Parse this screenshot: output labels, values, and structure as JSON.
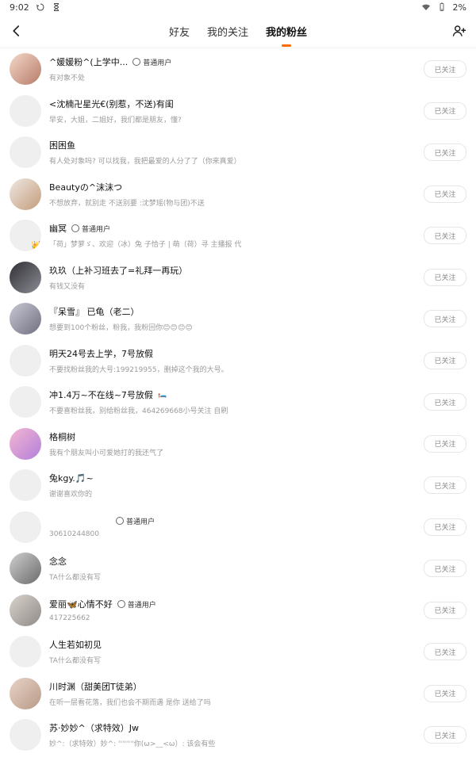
{
  "status_bar": {
    "time": "9:02",
    "battery": "2%"
  },
  "header": {
    "tabs": [
      {
        "label": "好友",
        "active": false
      },
      {
        "label": "我的关注",
        "active": false
      },
      {
        "label": "我的粉丝",
        "active": true
      }
    ]
  },
  "list": {
    "follow_label": "已关注",
    "items": [
      {
        "name": "^媛媛粉^(上学中...",
        "badge": "普通用户",
        "sub": "有对象不处",
        "avatar_icon": "user-photo"
      },
      {
        "name": "<沈楠卍星光€(别惹，不送)有闺",
        "badge": "",
        "sub": "早安，大姐，二姐好，我们都是朋友，懂?",
        "avatar_icon": ""
      },
      {
        "name": "困困鱼",
        "badge": "",
        "sub": "有人处对象吗? 可以找我，我把最爱的人分了了（你来真爱）",
        "avatar_icon": ""
      },
      {
        "name": "Beautyの^沫沫つ",
        "badge": "",
        "sub": "不想放弃，就别走 不送别要 :沈梦瑶(物与团)不送",
        "avatar_icon": "user-photo"
      },
      {
        "name": "幽冥",
        "badge": "普通用户",
        "sub": "「荷」梦萝ゞ、欢迎（冰）兔 子恰子 | 萌（荷）寻 主播报 代",
        "avatar_icon": "crown"
      },
      {
        "name": "玖玖（上补习班去了=礼拜一再玩）",
        "badge": "",
        "sub": "有钱又没有",
        "avatar_icon": "user-photo"
      },
      {
        "name": "『呆雪』 已龟（老二）",
        "badge": "",
        "sub": "想要到100个粉丝，粉我，我粉回你😊😊😊😊",
        "avatar_icon": "user-photo"
      },
      {
        "name": "明天24号去上学，7号放假",
        "badge": "",
        "sub": "不要找粉丝我的大号:199219955，删掉这个我的大号。",
        "avatar_icon": ""
      },
      {
        "name": "冲1.4万~不在线~7号放假",
        "badge": "",
        "sub": "不要喜粉丝我，别给粉丝我，464269668小号关注 自刷",
        "avatar_icon": ""
      },
      {
        "name": "格桐树",
        "badge": "",
        "sub": "我有个朋友叫小可爱她打的我还气了",
        "avatar_icon": "user-photo"
      },
      {
        "name": "兔kgy.🎵~",
        "badge": "",
        "sub": "谢谢喜欢你的",
        "avatar_icon": ""
      },
      {
        "name": "",
        "badge": "普通用户",
        "sub": "30610244800",
        "avatar_icon": ""
      },
      {
        "name": "念念",
        "badge": "",
        "sub": "TA什么都没有写",
        "avatar_icon": "user-photo"
      },
      {
        "name": "爱丽🦋心情不好",
        "badge": "普通用户",
        "sub": "417225662",
        "avatar_icon": "user-photo"
      },
      {
        "name": "人生若如初见",
        "badge": "",
        "sub": "TA什么都没有写",
        "avatar_icon": ""
      },
      {
        "name": "川时渊（甜美团T徒弟）",
        "badge": "",
        "sub": "在听一层看花落，我们也会不期而遇 是你 送给了吗",
        "avatar_icon": "user-photo"
      },
      {
        "name": "苏·妙妙^（求特效）Jw",
        "badge": "",
        "sub": "妙^:（求特效）妙^: ''''''''你(ω>__<ω）: 该会有些",
        "avatar_icon": ""
      }
    ]
  }
}
